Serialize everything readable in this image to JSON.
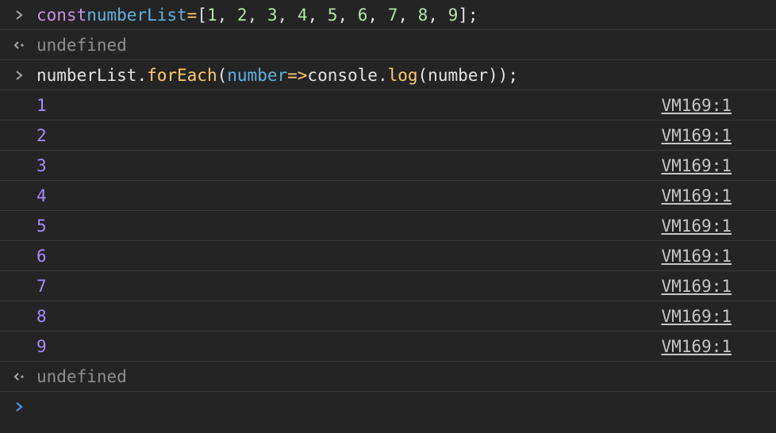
{
  "input1": {
    "keyword": "const",
    "name": "numberList",
    "assign": "=",
    "open": "[",
    "numbers": [
      "1",
      "2",
      "3",
      "4",
      "5",
      "6",
      "7",
      "8",
      "9"
    ],
    "close": "];"
  },
  "result1": "undefined",
  "input2": {
    "obj": "numberList",
    "dot1": ".",
    "method": "forEach",
    "paren_open": "(",
    "param": "number",
    "arrow": "=>",
    "console": "console",
    "dot2": ".",
    "log": "log",
    "args": "(number));"
  },
  "outputs": [
    {
      "value": "1",
      "source": "VM169:1"
    },
    {
      "value": "2",
      "source": "VM169:1"
    },
    {
      "value": "3",
      "source": "VM169:1"
    },
    {
      "value": "4",
      "source": "VM169:1"
    },
    {
      "value": "5",
      "source": "VM169:1"
    },
    {
      "value": "6",
      "source": "VM169:1"
    },
    {
      "value": "7",
      "source": "VM169:1"
    },
    {
      "value": "8",
      "source": "VM169:1"
    },
    {
      "value": "9",
      "source": "VM169:1"
    }
  ],
  "result2": "undefined",
  "icons": {
    "input_prompt": "chevron-right-icon",
    "result_marker": "return-arrow-icon",
    "active_prompt": "chevron-right-icon"
  },
  "colors": {
    "background": "#242424",
    "keyword": "#c792ea",
    "identifier": "#5fb3e0",
    "number_literal": "#b3e5a5",
    "output_number": "#a78bfa",
    "function": "#ffcb6b",
    "undefined": "#8f8f8f",
    "active_prompt": "#4d8fe8"
  }
}
